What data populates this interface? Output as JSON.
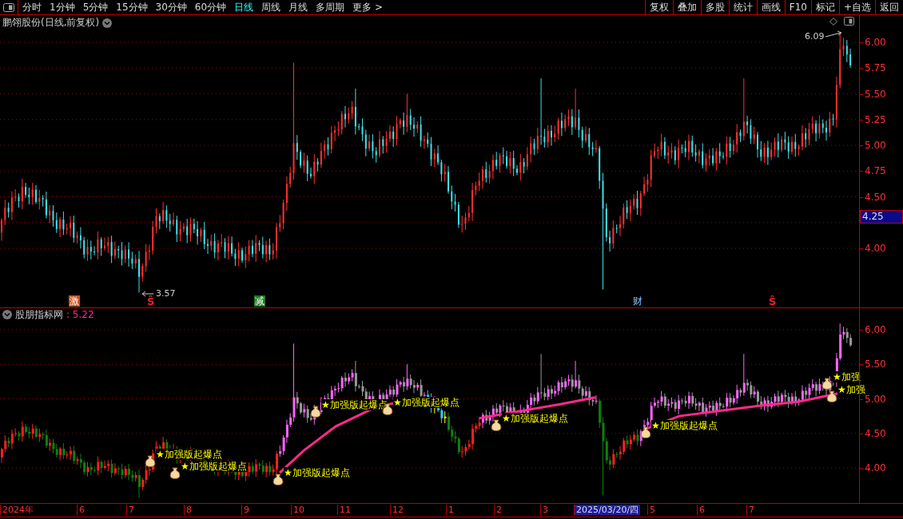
{
  "toolbar": {
    "periods": [
      {
        "label": "分时",
        "selected": false
      },
      {
        "label": "1分钟",
        "selected": false
      },
      {
        "label": "5分钟",
        "selected": false
      },
      {
        "label": "15分钟",
        "selected": false
      },
      {
        "label": "30分钟",
        "selected": false
      },
      {
        "label": "60分钟",
        "selected": false
      },
      {
        "label": "日线",
        "selected": true
      },
      {
        "label": "周线",
        "selected": false
      },
      {
        "label": "月线",
        "selected": false
      },
      {
        "label": "多周期",
        "selected": false
      },
      {
        "label": "更多 >",
        "selected": false
      }
    ],
    "actions": [
      "复权",
      "叠加",
      "多股",
      "统计",
      "画线",
      "F10",
      "标记",
      "+自选",
      "返回"
    ]
  },
  "main_chart": {
    "title": "鹏翎股份(日线,前复权)",
    "high_label": "6.09",
    "low_label": "3.57",
    "y_ticks": [
      "6.00",
      "5.75",
      "5.50",
      "5.25",
      "5.00",
      "4.75",
      "4.50",
      "4.00"
    ],
    "current_price": "4.25",
    "markers": [
      {
        "kind": "tag",
        "text": "激",
        "color": "#c8501e"
      },
      {
        "kind": "signal",
        "text": "Ŝ"
      },
      {
        "kind": "tag",
        "text": "减",
        "color": "#1e7a1e"
      },
      {
        "kind": "note",
        "text": "财"
      },
      {
        "kind": "signal",
        "text": "Ŝ"
      }
    ]
  },
  "indicator": {
    "title": "股朋指标网",
    "value": ": 5.22",
    "y_ticks": [
      "6.00",
      "5.50",
      "5.00",
      "4.50",
      "4.00"
    ],
    "signals": [
      {
        "label": "★加强版起爆点"
      },
      {
        "label": "★加强版起爆点"
      },
      {
        "label": "★加强版起爆点"
      },
      {
        "label": "★加强版起爆点"
      },
      {
        "label": "★加强版起爆点"
      },
      {
        "label": "★加强版起爆点"
      },
      {
        "label": "★加强版起爆点"
      },
      {
        "label": "★加强"
      },
      {
        "label": "★加强"
      }
    ]
  },
  "date_axis": [
    {
      "label": "2024年",
      "selected": false
    },
    {
      "label": "6",
      "selected": false
    },
    {
      "label": "7",
      "selected": false
    },
    {
      "label": "8",
      "selected": false
    },
    {
      "label": "9",
      "selected": false
    },
    {
      "label": "10",
      "selected": false
    },
    {
      "label": "11",
      "selected": false
    },
    {
      "label": "12",
      "selected": false
    },
    {
      "label": "1",
      "selected": false
    },
    {
      "label": "2",
      "selected": false
    },
    {
      "label": "3",
      "selected": false
    },
    {
      "label": "2025/03/20/四",
      "selected": true
    },
    {
      "label": "5",
      "selected": false
    },
    {
      "label": "6",
      "selected": false
    },
    {
      "label": "7",
      "selected": false
    }
  ]
}
